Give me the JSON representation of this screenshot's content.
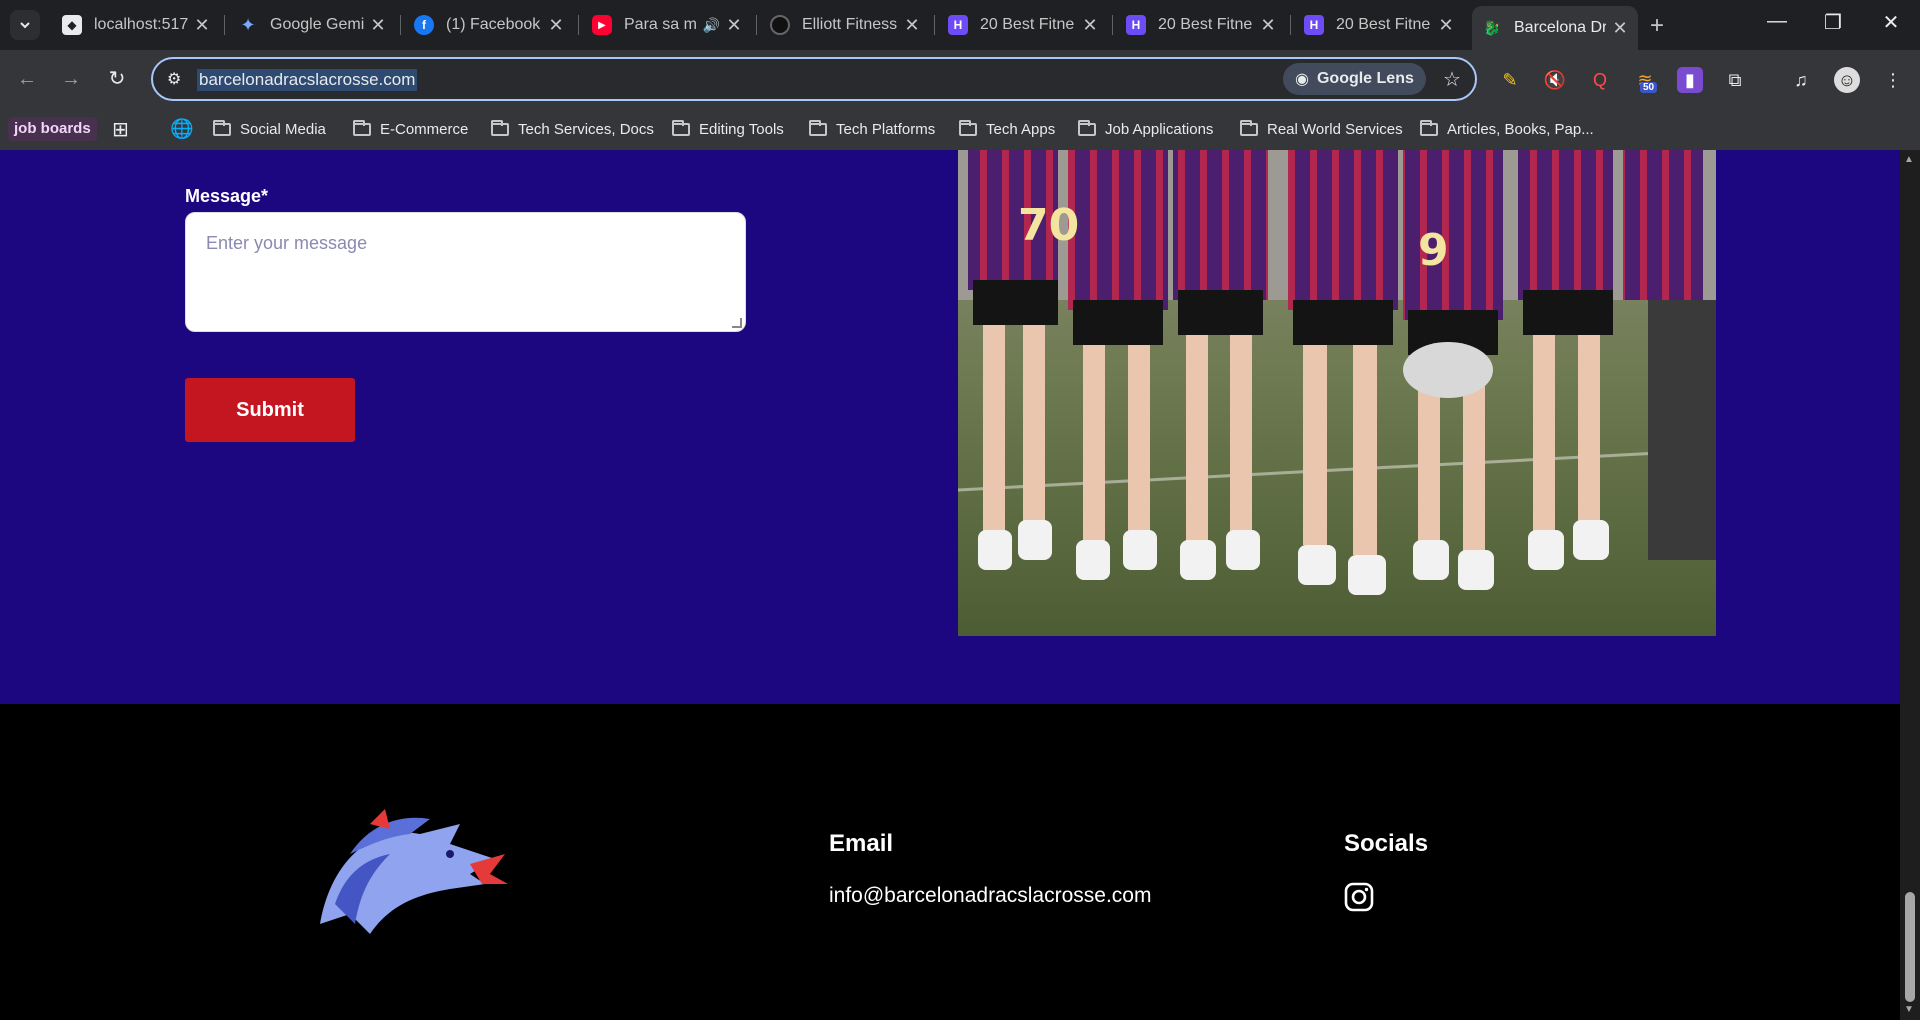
{
  "tabs": [
    {
      "title": "localhost:517",
      "favicon": "file-icon"
    },
    {
      "title": "Google Gemi",
      "favicon": "gemini-icon"
    },
    {
      "title": "(1) Facebook",
      "favicon": "facebook-icon"
    },
    {
      "title": "Para sa m",
      "favicon": "youtube-icon"
    },
    {
      "title": "Elliott Fitness",
      "favicon": "elliott-icon"
    },
    {
      "title": "20 Best Fitne",
      "favicon": "h-icon"
    },
    {
      "title": "20 Best Fitne",
      "favicon": "h-icon"
    },
    {
      "title": "20 Best Fitne",
      "favicon": "h-icon"
    },
    {
      "title": "Barcelona Dr",
      "favicon": "dragon-icon"
    }
  ],
  "address": {
    "url": "barcelonadracslacrosse.com",
    "lens_label": "Google Lens",
    "ext_badge": "50"
  },
  "bookmarks": {
    "job_boards": "job boards",
    "folders": [
      "Social Media",
      "E-Commerce",
      "Tech Services, Docs",
      "Editing Tools",
      "Tech Platforms",
      "Tech Apps",
      "Job Applications",
      "Real World Services",
      "Articles, Books, Pap..."
    ]
  },
  "form": {
    "message_label": "Message*",
    "message_placeholder": "Enter your message",
    "submit_label": "Submit"
  },
  "footer": {
    "email_heading": "Email",
    "email_value": "info@barcelonadracslacrosse.com",
    "socials_heading": "Socials"
  },
  "colors": {
    "page_purple": "#1c0780",
    "submit_red": "#c41620",
    "footer_bg": "#000000"
  }
}
